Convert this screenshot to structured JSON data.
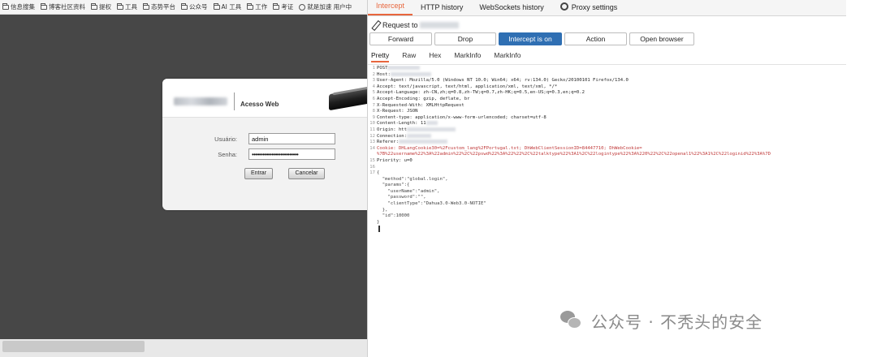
{
  "bookmarks": [
    {
      "label": "信息搜集",
      "icon": "folder-icon"
    },
    {
      "label": "博客社区资料",
      "icon": "folder-icon"
    },
    {
      "label": "提权",
      "icon": "folder-icon"
    },
    {
      "label": "工具",
      "icon": "folder-icon"
    },
    {
      "label": "态势平台",
      "icon": "folder-icon"
    },
    {
      "label": "公众号",
      "icon": "folder-icon"
    },
    {
      "label": "AI 工具",
      "icon": "folder-icon"
    },
    {
      "label": "工作",
      "icon": "folder-icon"
    },
    {
      "label": "考证",
      "icon": "folder-icon"
    },
    {
      "label": "就是加速 用户中",
      "icon": "globe-icon"
    }
  ],
  "login": {
    "title": "Acesso Web",
    "username_label": "Usuário:",
    "username_value": "admin",
    "password_label": "Senha:",
    "password_value": "••••••••••••••••••••••••••",
    "enter_label": "Entrar",
    "cancel_label": "Cancelar"
  },
  "burp": {
    "tabs": [
      "Intercept",
      "HTTP history",
      "WebSockets history",
      "Proxy settings"
    ],
    "active_tab": "Intercept",
    "request_label": "Request to",
    "actions": {
      "forward": "Forward",
      "drop": "Drop",
      "intercept": "Intercept is on",
      "action": "Action",
      "open_browser": "Open browser"
    },
    "subtabs": [
      "Pretty",
      "Raw",
      "Hex",
      "MarkInfo",
      "MarkInfo"
    ],
    "active_subtab": "Pretty",
    "accent_color": "#e8663d",
    "intercept_on_color": "#2f6fb3",
    "lines": [
      {
        "n": "1",
        "text": "POST",
        "style": "",
        "blur": 40
      },
      {
        "n": "2",
        "text": "Host:",
        "style": "",
        "blur": 50
      },
      {
        "n": "3",
        "text": "User-Agent: Mozilla/5.0 (Windows NT 10.0; Win64; x64; rv:134.0) Gecko/20100101 Firefox/134.0",
        "style": "",
        "blur": 0
      },
      {
        "n": "4",
        "text": "Accept: text/javascript, text/html, application/xml, text/xml, */*",
        "style": "",
        "blur": 0
      },
      {
        "n": "5",
        "text": "Accept-Language: zh-CN,zh;q=0.8,zh-TW;q=0.7,zh-HK;q=0.5,en-US;q=0.3,en;q=0.2",
        "style": "",
        "blur": 0
      },
      {
        "n": "6",
        "text": "Accept-Encoding: gzip, deflate, br",
        "style": "",
        "blur": 0
      },
      {
        "n": "7",
        "text": "X-Requested-With: XMLHttpRequest",
        "style": "",
        "blur": 0
      },
      {
        "n": "8",
        "text": "X-Request: JSON",
        "style": "",
        "blur": 0
      },
      {
        "n": "9",
        "text": "Content-type: application/x-www-form-urlencoded; charset=utf-8",
        "style": "",
        "blur": 0
      },
      {
        "n": "10",
        "text": "Content-Length: 11",
        "style": "",
        "blur": 14
      },
      {
        "n": "11",
        "text": "Origin: htt",
        "style": "",
        "blur": 60
      },
      {
        "n": "12",
        "text": "Connection:",
        "style": "",
        "blur": 30
      },
      {
        "n": "13",
        "text": "Referer:",
        "style": "",
        "blur": 60
      },
      {
        "n": "14",
        "text": "Cookie: DHLangCookie30=%2Fcustom_lang%2FPortugal.txt; DhWebClientSessionID=84447710; DhWebCookie=",
        "style": "red",
        "blur": 0
      },
      {
        "n": "",
        "text": "%7B%22username%22%3A%22admin%22%2C%22pswd%22%3A%22%22%2C%22talktype%22%3A1%2C%22logintype%22%3A%220%22%2C%22openal1%22%3A1%2C%22loginid%22%3A%7D",
        "style": "red",
        "blur": 0
      },
      {
        "n": "15",
        "text": "Priority: u=0",
        "style": "",
        "blur": 0
      },
      {
        "n": "16",
        "text": "",
        "style": "",
        "blur": 0
      },
      {
        "n": "17",
        "text": "{",
        "style": "json",
        "blur": 0
      },
      {
        "n": "",
        "text": "  \"method\":\"global.login\",",
        "style": "json",
        "blur": 0
      },
      {
        "n": "",
        "text": "  \"params\":{",
        "style": "json",
        "blur": 0
      },
      {
        "n": "",
        "text": "    \"userName\":\"admin\",",
        "style": "json",
        "blur": 0
      },
      {
        "n": "",
        "text": "    \"password\":\"\",",
        "style": "json",
        "blur": 0
      },
      {
        "n": "",
        "text": "    \"clientType\":\"Dahua3.0-Web3.0-NOTIE\"",
        "style": "json",
        "blur": 0
      },
      {
        "n": "",
        "text": "  },",
        "style": "json",
        "blur": 0
      },
      {
        "n": "",
        "text": "  \"id\":10000",
        "style": "json",
        "blur": 0
      },
      {
        "n": "",
        "text": "}",
        "style": "json",
        "blur": 0
      }
    ]
  },
  "watermark": {
    "icon": "wechat-icon",
    "text": "公众号 · 不秃头的安全"
  }
}
